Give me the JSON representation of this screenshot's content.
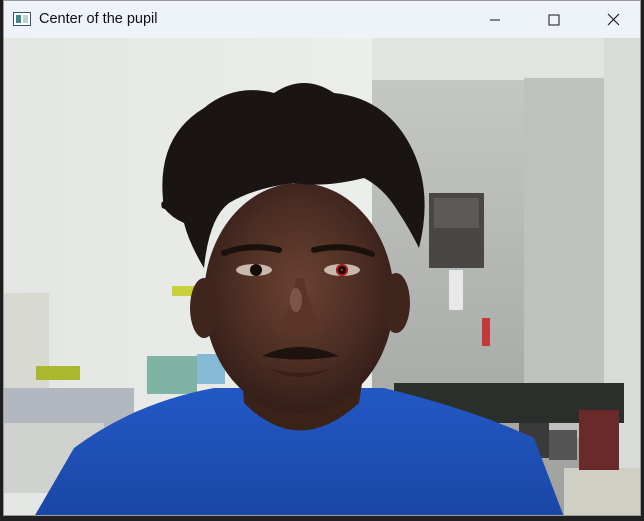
{
  "window": {
    "title": "Center of the pupil",
    "icons": {
      "app": "opencv-window-icon",
      "minimize": "minimize-icon",
      "maximize": "maximize-icon",
      "close": "close-icon"
    }
  },
  "image": {
    "description_type": "webcam-frame",
    "pupil_marker_color": "#d01818"
  },
  "colors": {
    "titlebar": "#eef3fa",
    "wall": "#e9ebe9",
    "shirt": "#1d4fb8",
    "hair": "#1a1412"
  }
}
